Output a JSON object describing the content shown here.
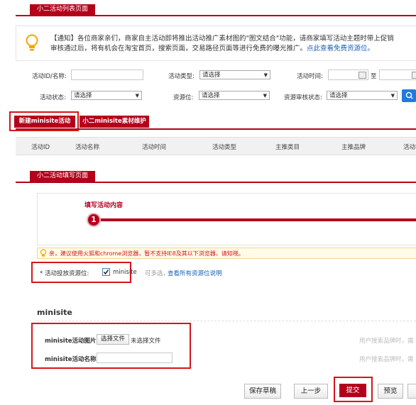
{
  "tabs": {
    "list_page": "小二活动列表页面",
    "fill_page": "小二活动填写页面"
  },
  "notice": {
    "line1": "【通知】各位商家亲们，商家自主活动即将推出活动推广素材图的\"图文结合\"功能，请商家填写活动主题时带上促销",
    "line2": "审核通过后，将有机会在淘宝首页，搜索页面，交易路径页面等进行免费的曝光推广。",
    "link": "点此查看免费资源位。"
  },
  "filters": {
    "activity_id_label": "活动ID/名称:",
    "activity_type_label": "活动类型:",
    "activity_type_value": "请选择",
    "activity_time_label": "活动时间:",
    "date_to": "至",
    "activity_status_label": "活动状态:",
    "activity_status_value": "请选择",
    "resource_label": "资源位:",
    "resource_value": "请选择",
    "resource_audit_label": "资源审核状态:",
    "resource_audit_value": "请选择"
  },
  "actions": {
    "new_minisite": "新建minisite活动",
    "material_maintain": "小二minisite素材维护"
  },
  "table": {
    "headers": [
      "活动ID",
      "活动名称",
      "活动时间",
      "活动类型",
      "主推类目",
      "主推品牌",
      "活动状"
    ]
  },
  "form": {
    "step_label": "填写活动内容",
    "step_number": "1",
    "warning": "亲，建议使用火狐和chrome浏览器，暂不支持IE8及其以下浏览器，请知晓。",
    "placement_label": "* 活动投放资源位:",
    "placement_option": "minisite",
    "placement_hint": "可多选，",
    "placement_link": "查看所有资源位说明",
    "section_title": "minisite",
    "image_label": "minisite活动图片",
    "choose_file": "选择文件",
    "no_file": "未选择文件",
    "name_label": "minisite活动名称",
    "right_hint1": "用户搜索品牌时，需",
    "right_hint2": "用户搜索品牌时，需"
  },
  "buttons": {
    "save_draft": "保存草稿",
    "prev_step": "上一步",
    "submit": "提交",
    "preview": "预览"
  },
  "colors": {
    "brand_red": "#b3001b",
    "highlight_red": "#d7141a",
    "link_blue": "#1a5fb4"
  }
}
